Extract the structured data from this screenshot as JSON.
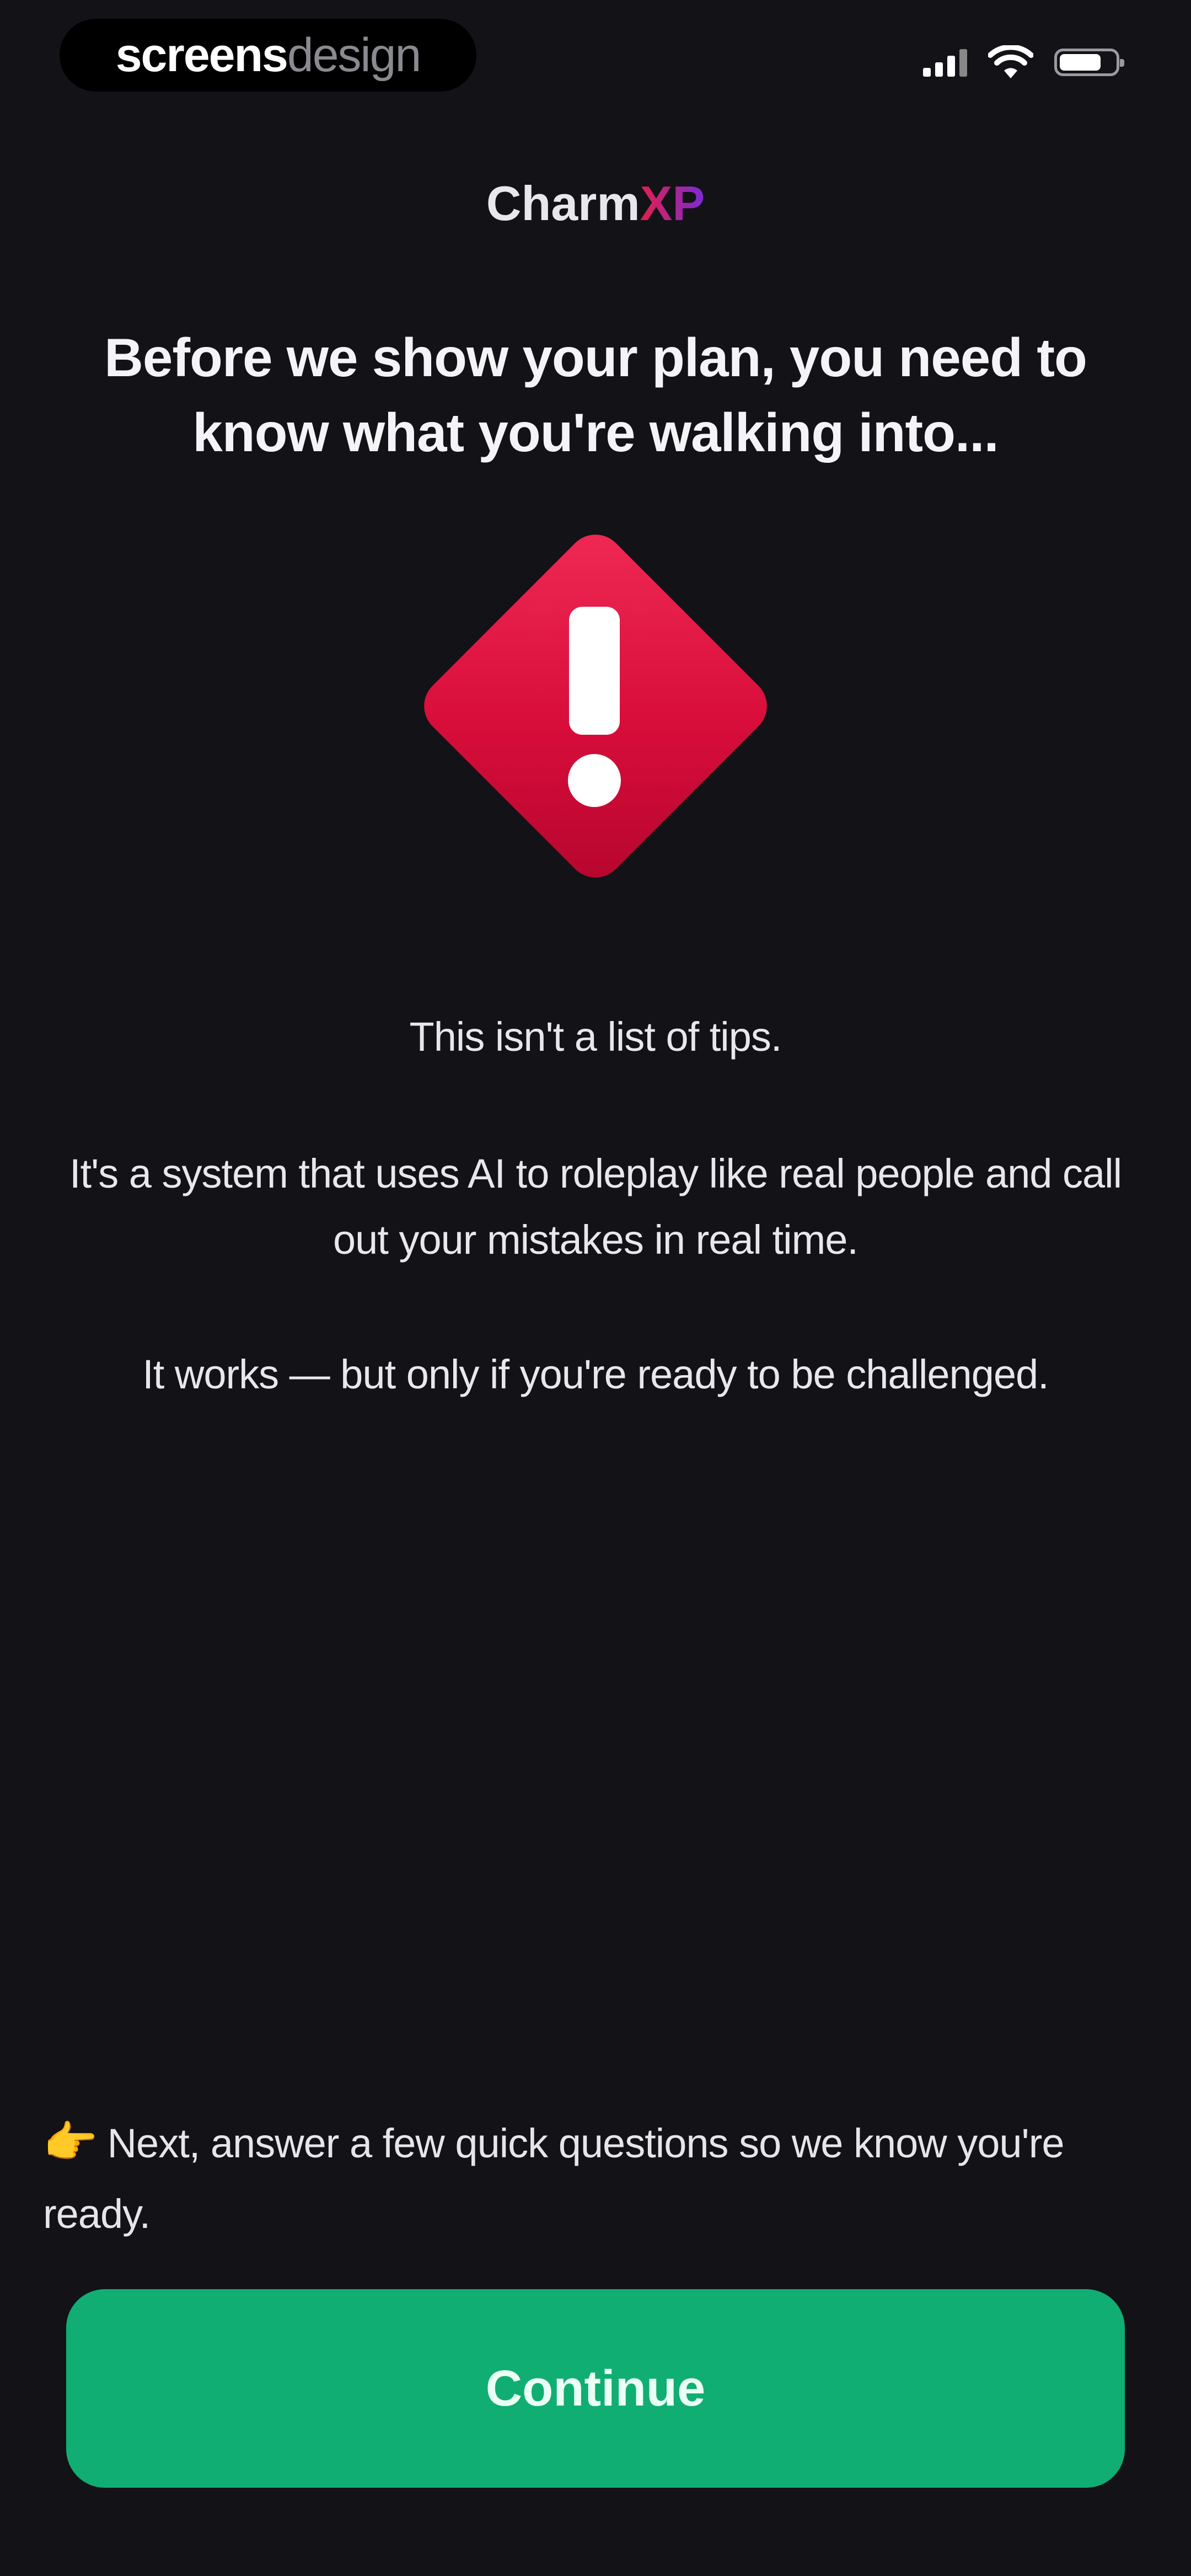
{
  "status_bar": {
    "watermark_bold": "screens",
    "watermark_light": "design",
    "signal_icon": "signal-icon",
    "wifi_icon": "wifi-icon",
    "battery_icon": "battery-icon"
  },
  "brand": {
    "name_main": "Charm",
    "name_accent": "XP"
  },
  "headline": "Before we show your plan, you need to know what you're walking into...",
  "warning_icon": "exclamation-diamond-icon",
  "paragraphs": {
    "p1": "This isn't a list of tips.",
    "p2": "It's a system that uses AI to roleplay like real people and call out your mistakes in real time.",
    "p3": "It works — but only if you're ready to be challenged."
  },
  "hint": {
    "icon": "👉",
    "text": "Next, answer a few quick questions so we know you're ready."
  },
  "continue_label": "Continue",
  "colors": {
    "background": "#121217",
    "button": "#10ae72",
    "warning": "#d80d3a",
    "brand_accent_start": "#e0204a",
    "brand_accent_end": "#7a2ad8"
  }
}
